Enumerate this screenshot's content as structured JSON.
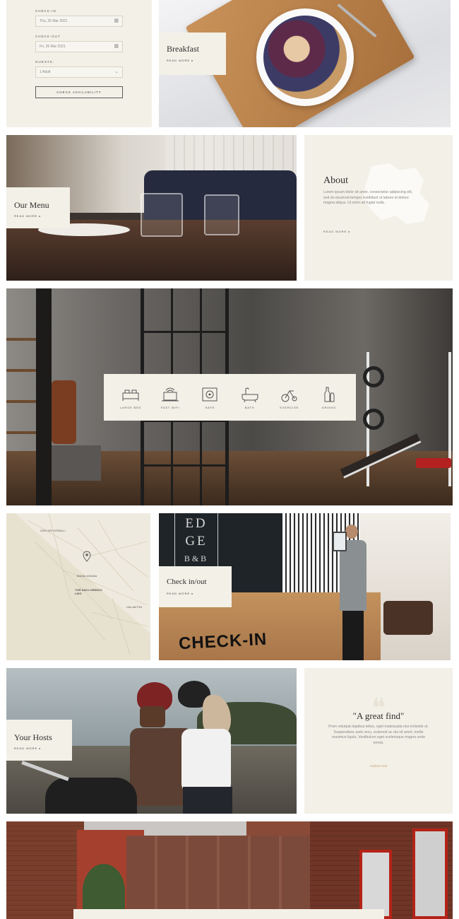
{
  "booking": {
    "checkin_label": "CHECK-IN",
    "checkin_value": "Thu, 25 Mar 2021",
    "checkout_label": "CHECK-OUT",
    "checkout_value": "Fri, 26 Mar 2021",
    "guests_label": "GUESTS:",
    "guests_value": "1 Adult",
    "button": "CHECK AVAILABILITY"
  },
  "breakfast": {
    "title": "Breakfast",
    "link": "READ MORE ▸"
  },
  "menu": {
    "title": "Our Menu",
    "link": "READ MORE ▸"
  },
  "about": {
    "title": "About",
    "text": "Lorem ipsum dolor sit amet, consectetur adipiscing elit, sed do eiusmod tempor incididunt ut labore et dolore magna aliqua. Ut enim ad fugiat nulla.",
    "link": "READ MORE ▸"
  },
  "amenities": [
    {
      "label": "LARGE BED",
      "icon": "bed-icon"
    },
    {
      "label": "FAST WIFI",
      "icon": "wifi-laptop-icon"
    },
    {
      "label": "SAFE",
      "icon": "safe-icon"
    },
    {
      "label": "BATH",
      "icon": "bathtub-icon"
    },
    {
      "label": "EXERCISE",
      "icon": "exercise-bike-icon"
    },
    {
      "label": "DRINKS",
      "icon": "bottles-icon"
    }
  ],
  "map": {
    "places": [
      "LIDO DEI GORALLI",
      "TOR SAN LORENZO LIDO",
      "Marina di Ardea",
      "Tor San Lorenzo",
      "Lido dei Pini"
    ]
  },
  "checkin": {
    "title": "Check in/out",
    "link": "READ MORE ▸",
    "desk_sign": "CHECK-IN",
    "wall_sign": [
      "ED",
      "GE",
      "B&B"
    ]
  },
  "hosts": {
    "title": "Your Hosts",
    "link": "READ MORE ▸"
  },
  "quote": {
    "title": "\"A great find\"",
    "text": "Proin volutpat dapibus tellus, eget malesuada nisi molestie ut. Suspendisse justo arcu, euismod ac dui sit amet, mollis maximus ligula. Vestibulum eget scelerisque magna unde omnis.",
    "author": "Andrew Hart"
  },
  "colors": {
    "cream": "#f3f0e7",
    "text": "#2e2e2e",
    "accent": "#c9a27a"
  }
}
